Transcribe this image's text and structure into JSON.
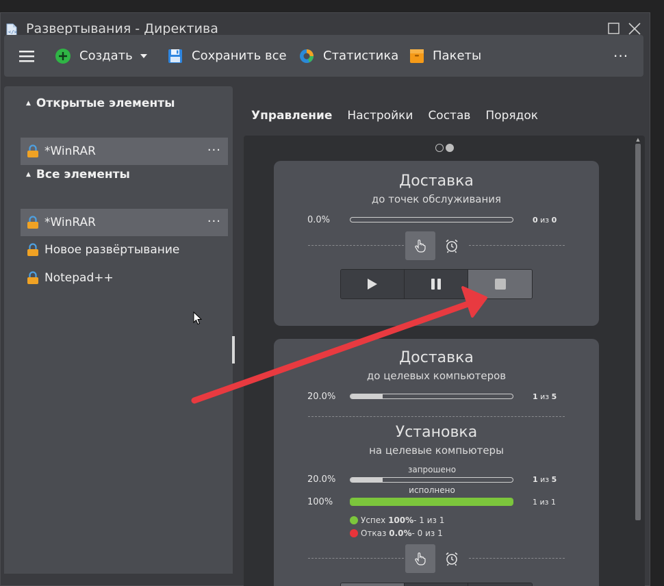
{
  "window": {
    "title": "Развертывания - Директива"
  },
  "toolbar": {
    "create_label": "Создать",
    "save_all_label": "Сохранить все",
    "statistics_label": "Статистика",
    "packages_label": "Пакеты",
    "more_label": "···"
  },
  "sidebar": {
    "open_header": "Открытые элементы",
    "open_items": [
      {
        "label": "*WinRAR",
        "more": "···"
      }
    ],
    "all_header": "Все элементы",
    "all_items": [
      {
        "label": "*WinRAR",
        "more": "···"
      },
      {
        "label": "Новое развёртывание"
      },
      {
        "label": "Notepad++"
      }
    ]
  },
  "tabs": [
    {
      "label": "Управление"
    },
    {
      "label": "Настройки"
    },
    {
      "label": "Состав"
    },
    {
      "label": "Порядок"
    }
  ],
  "card1": {
    "title": "Доставка",
    "subtitle": "до точек обслуживания",
    "percent_text": "0.0%",
    "progress": 0,
    "count_done": "0",
    "count_sep": "из",
    "count_total": "0"
  },
  "card2": {
    "delivery_title": "Доставка",
    "delivery_subtitle": "до целевых компьютеров",
    "delivery_percent": "20.0%",
    "delivery_progress": 0.2,
    "delivery_count_done": "1",
    "delivery_count_sep": "из",
    "delivery_count_total": "5",
    "install_title": "Установка",
    "install_subtitle": "на целевые компьютеры",
    "requested_label": "запрошено",
    "requested_percent": "20.0%",
    "requested_progress": 0.2,
    "requested_count_done": "1",
    "requested_count_sep": "из",
    "requested_count_total": "5",
    "executed_label": "исполнено",
    "executed_percent": "100%",
    "executed_progress": 1.0,
    "executed_count_done": "1",
    "executed_count_sep": "из",
    "executed_count_total": "1",
    "success_label": "Успех",
    "success_pct": "100%",
    "success_rest": " - 1 из 1",
    "fail_label": "Отказ",
    "fail_pct": "0.0%",
    "fail_rest": " - 0 из 1"
  },
  "colors": {
    "accent_green": "#7cc63c",
    "fail_red": "#e8343a",
    "arrow_red": "#e83a40"
  }
}
